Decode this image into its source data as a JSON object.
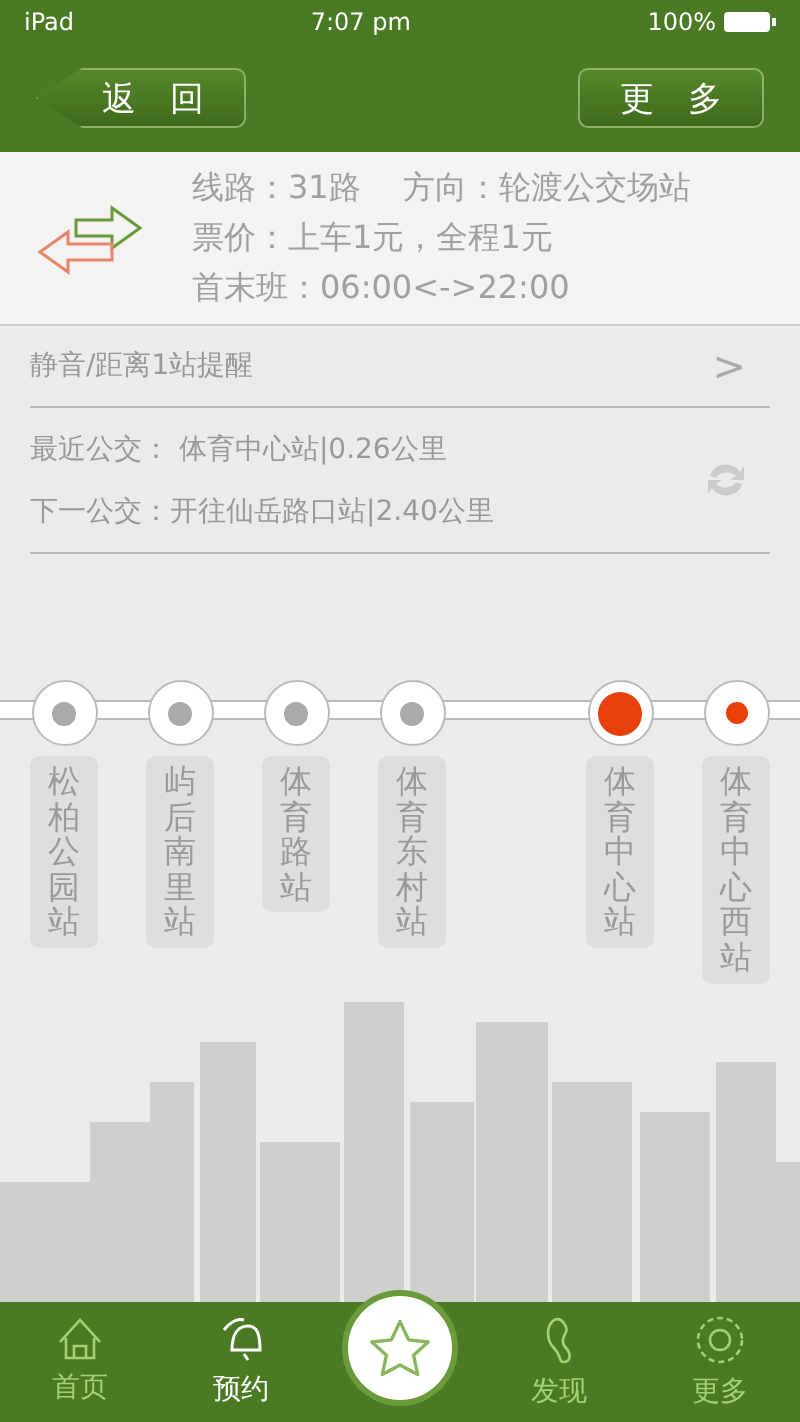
{
  "status_bar": {
    "device": "iPad",
    "time": "7:07 pm",
    "battery": "100%"
  },
  "nav": {
    "back": "返　回",
    "more": "更　多"
  },
  "route_info": {
    "lines": [
      "线路：31路　 方向：轮渡公交场站",
      "票价：上车1元，全程1元",
      "首末班：06:00<->22:00"
    ]
  },
  "reminder": {
    "label": "静音/距离1站提醒",
    "chevron": ">"
  },
  "bus_info": {
    "nearest": "最近公交：  体育中心站|0.26公里",
    "next": "下一公交：开往仙岳路口站|2.40公里"
  },
  "stops": [
    {
      "name": "松柏公园站",
      "kind": "normal"
    },
    {
      "name": "屿后南里站",
      "kind": "normal"
    },
    {
      "name": "体育路站",
      "kind": "normal"
    },
    {
      "name": "体育东村站",
      "kind": "normal"
    },
    {
      "name": "体育中心站",
      "kind": "bus"
    },
    {
      "name": "体育中心西站",
      "kind": "target"
    }
  ],
  "tab_bar": [
    {
      "label": "首页",
      "selected": false
    },
    {
      "label": "预约",
      "selected": true
    },
    {
      "label": "发现",
      "selected": false
    },
    {
      "label": "更多",
      "selected": false
    }
  ]
}
